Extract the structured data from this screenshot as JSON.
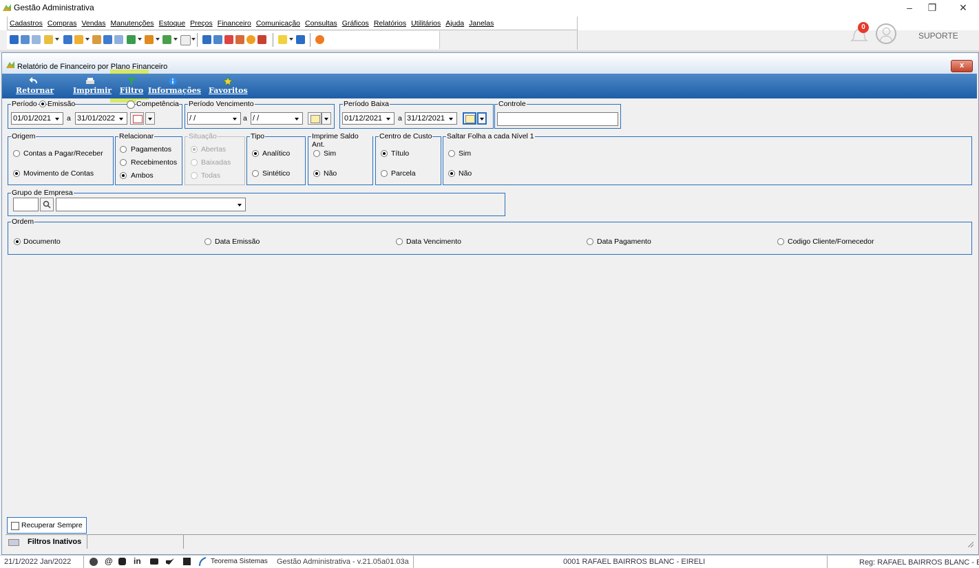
{
  "app": {
    "title": "Gestão Administrativa"
  },
  "window_controls": {
    "minimize": "–",
    "restore": "❐",
    "close": "✕"
  },
  "menu": [
    "Cadastros",
    "Compras",
    "Vendas",
    "Manutenções",
    "Estoque",
    "Preços",
    "Financeiro",
    "Comunicação",
    "Consultas",
    "Gráficos",
    "Relatórios",
    "Utilitários",
    "Ajuda",
    "Janelas"
  ],
  "top_right": {
    "notification_count": "0",
    "user": "SUPORTE"
  },
  "report": {
    "title": "Relatório de Financeiro por Plano Financeiro",
    "close_label": "x",
    "ribbon": [
      {
        "label": "Retornar",
        "icon": "return-icon"
      },
      {
        "label": "Imprimir",
        "icon": "printer-icon"
      },
      {
        "label": "Filtro",
        "icon": "filter-icon"
      },
      {
        "label": "Informações",
        "icon": "info-icon"
      },
      {
        "label": "Favoritos",
        "icon": "star-icon"
      }
    ],
    "periodo": {
      "label": "Período",
      "emissao": "Emissão",
      "competencia": "Competência",
      "from": "01/01/2021",
      "sep": "a",
      "to": "31/01/2022"
    },
    "vencimento": {
      "label": "Período Vencimento",
      "from": "/ /",
      "sep": "a",
      "to": "/ /"
    },
    "baixa": {
      "label": "Período Baixa",
      "from": "01/12/2021",
      "sep": "a",
      "to": "31/12/2021"
    },
    "controle": {
      "label": "Controle",
      "value": ""
    },
    "origem": {
      "label": "Origem",
      "opt1": "Contas a Pagar/Receber",
      "opt2": "Movimento de Contas",
      "selected": "Movimento de Contas"
    },
    "relacionar": {
      "label": "Relacionar",
      "opt1": "Pagamentos",
      "opt2": "Recebimentos",
      "opt3": "Ambos",
      "selected": "Ambos"
    },
    "situacao": {
      "label": "Situação",
      "opt1": "Abertas",
      "opt2": "Baixadas",
      "opt3": "Todas",
      "selected": "Abertas"
    },
    "tipo": {
      "label": "Tipo",
      "opt1": "Analítico",
      "opt2": "Sintético",
      "selected": "Analítico"
    },
    "saldo": {
      "label": "Imprime Saldo Ant.",
      "opt1": "Sim",
      "opt2": "Não",
      "selected": "Não"
    },
    "centro": {
      "label": "Centro de Custo",
      "opt1": "Título",
      "opt2": "Parcela",
      "selected": "Título"
    },
    "saltar": {
      "label": "Saltar Folha a cada Nível 1",
      "opt1": "Sim",
      "opt2": "Não",
      "selected": "Não"
    },
    "grupo": {
      "label": "Grupo de Empresa",
      "code": "",
      "name": ""
    },
    "ordem": {
      "label": "Ordem",
      "opts": [
        "Documento",
        "Data Emissão",
        "Data Vencimento",
        "Data Pagamento",
        "Codigo Cliente/Fornecedor"
      ],
      "selected": "Documento"
    },
    "recuperar": "Recuperar Sempre",
    "filtros_inativos": "Filtros Inativos"
  },
  "footer": {
    "date": "21/1/2022 Jan/2022",
    "company_brand": "Teorema Sistemas",
    "version": "Gestão Administrativa - v.21.05a01.03a",
    "company": "0001 RAFAEL BAIRROS BLANC - EIRELI",
    "reg": "Reg: RAFAEL BAIRROS BLANC - EIRI"
  },
  "colors": {
    "ribbon": "#1e5ea8",
    "group_border": "#2a6fbf",
    "highlight": "#d6e84c"
  }
}
